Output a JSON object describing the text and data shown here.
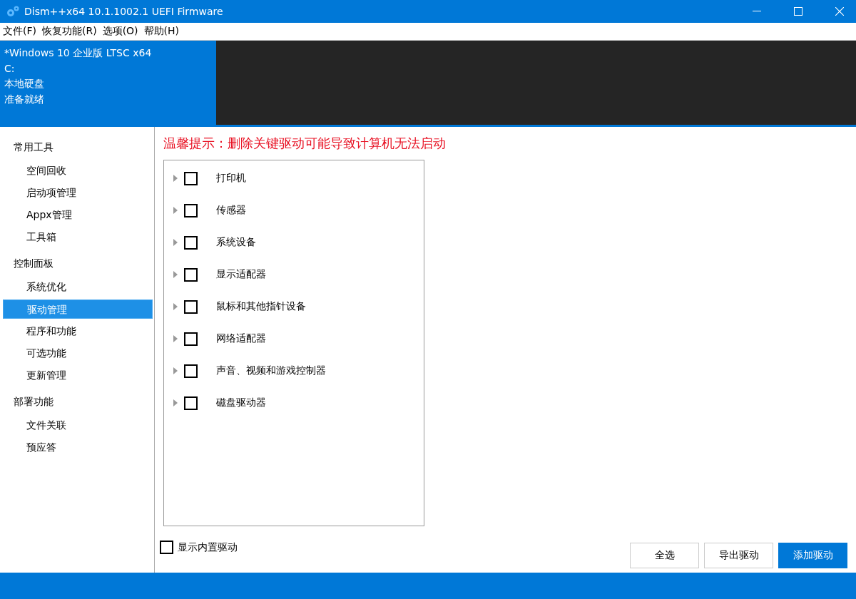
{
  "window": {
    "title": "Dism++x64 10.1.1002.1 UEFI Firmware"
  },
  "menu": [
    "文件(F)",
    "恢复功能(R)",
    "选项(O)",
    "帮助(H)"
  ],
  "image_info": {
    "lines": [
      "*Windows 10 企业版 LTSC x64",
      "C:",
      "本地硬盘",
      "准备就绪"
    ]
  },
  "sidebar": {
    "groups": [
      {
        "title": "常用工具",
        "items": [
          {
            "label": "空间回收",
            "selected": false
          },
          {
            "label": "启动项管理",
            "selected": false
          },
          {
            "label": "Appx管理",
            "selected": false
          },
          {
            "label": "工具箱",
            "selected": false
          }
        ]
      },
      {
        "title": "控制面板",
        "items": [
          {
            "label": "系统优化",
            "selected": false
          },
          {
            "label": "驱动管理",
            "selected": true
          },
          {
            "label": "程序和功能",
            "selected": false
          },
          {
            "label": "可选功能",
            "selected": false
          },
          {
            "label": "更新管理",
            "selected": false
          }
        ]
      },
      {
        "title": "部署功能",
        "items": [
          {
            "label": "文件关联",
            "selected": false
          },
          {
            "label": "预应答",
            "selected": false
          }
        ]
      }
    ]
  },
  "warning": "温馨提示：删除关键驱动可能导致计算机无法启动",
  "driver_tree": [
    {
      "label": "打印机",
      "checked": false,
      "expanded": false
    },
    {
      "label": "传感器",
      "checked": false,
      "expanded": false
    },
    {
      "label": "系统设备",
      "checked": false,
      "expanded": false
    },
    {
      "label": "显示适配器",
      "checked": false,
      "expanded": false
    },
    {
      "label": "鼠标和其他指针设备",
      "checked": false,
      "expanded": false
    },
    {
      "label": "网络适配器",
      "checked": false,
      "expanded": false
    },
    {
      "label": "声音、视频和游戏控制器",
      "checked": false,
      "expanded": false
    },
    {
      "label": "磁盘驱动器",
      "checked": false,
      "expanded": false
    }
  ],
  "show_builtin": {
    "label": "显示内置驱动",
    "checked": false
  },
  "buttons": [
    {
      "label": "全选",
      "kind": "secondary"
    },
    {
      "label": "导出驱动",
      "kind": "secondary"
    },
    {
      "label": "添加驱动",
      "kind": "primary"
    }
  ]
}
